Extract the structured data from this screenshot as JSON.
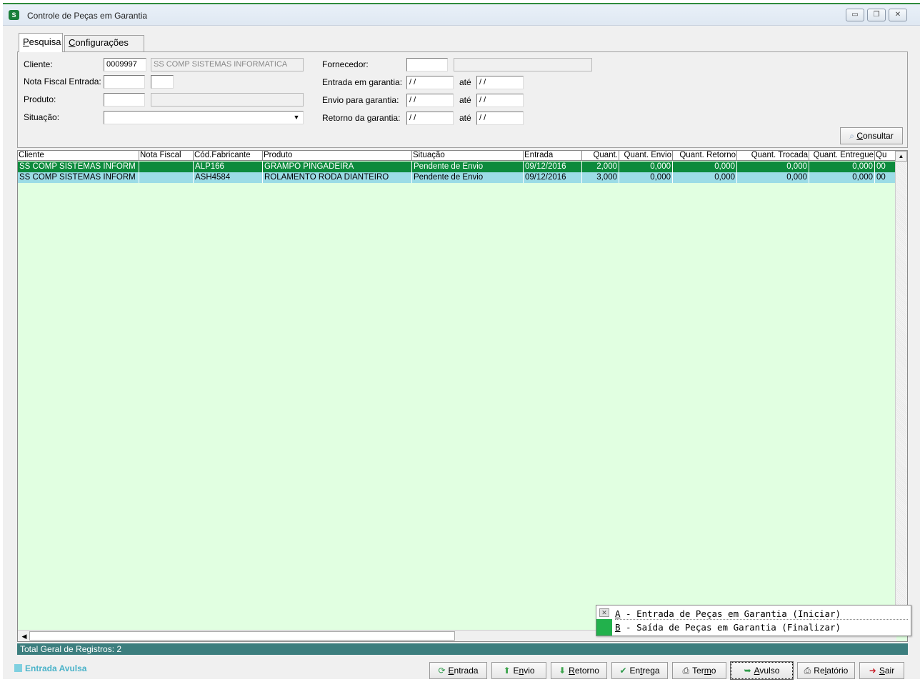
{
  "window": {
    "title": "Controle de Peças em Garantia",
    "controls": [
      "minimize",
      "restore",
      "close"
    ]
  },
  "tabs": [
    {
      "label": "Pesquisa",
      "underline": "P",
      "rest": "esquisa",
      "active": true
    },
    {
      "label": "Configurações",
      "underline": "C",
      "rest": "onfigurações",
      "active": false
    }
  ],
  "search": {
    "cliente_label": "Cliente:",
    "cliente_code": "0009997",
    "cliente_name": "SS COMP SISTEMAS INFORMATICA",
    "nota_label": "Nota Fiscal Entrada:",
    "nota_value": "",
    "nota_serie": "",
    "produto_label": "Produto:",
    "produto_code": "",
    "produto_name": "",
    "situacao_label": "Situação:",
    "situacao_value": "",
    "fornecedor_label": "Fornecedor:",
    "fornecedor_code": "",
    "fornecedor_name": "",
    "entrada_label": "Entrada em garantia:",
    "envio_label": "Envio para garantia:",
    "retorno_label": "Retorno da garantia:",
    "ate_label": "até",
    "date_empty": " / /",
    "consultar_label": "Consultar",
    "consultar_u": "C",
    "consultar_rest": "onsultar"
  },
  "grid": {
    "columns": [
      "Cliente",
      "Nota Fiscal",
      "Cód.Fabricante",
      "Produto",
      "Situação",
      "Entrada",
      "Quant.",
      "Quant. Envio",
      "Quant. Retorno",
      "Quant. Trocada",
      "Quant. Entregue",
      "Qu"
    ],
    "rows": [
      {
        "cliente": "SS COMP SISTEMAS INFORM",
        "nota": "",
        "cod": "ALP166",
        "produto": "GRAMPO PINGADEIRA",
        "situacao": "Pendente de Envio",
        "entrada": "09/12/2016",
        "quant": "2,000",
        "envio": "0,000",
        "retorno": "0,000",
        "trocada": "0,000",
        "entregue": "0,000",
        "extra": "00"
      },
      {
        "cliente": "SS COMP SISTEMAS INFORM",
        "nota": "",
        "cod": "ASH4584",
        "produto": "ROLAMENTO RODA DIANTEIRO",
        "situacao": "Pendente de Envio",
        "entrada": "09/12/2016",
        "quant": "3,000",
        "envio": "0,000",
        "retorno": "0,000",
        "trocada": "0,000",
        "entregue": "0,000",
        "extra": "00"
      }
    ]
  },
  "status": {
    "total": "Total Geral de Registros: 2",
    "legend": "Entrada Avulsa"
  },
  "popup": {
    "item_a_key": "A",
    "item_a_text": " - Entrada de Peças em Garantia (Iniciar)",
    "item_b_key": "B",
    "item_b_text": " - Saída de Peças em Garantia (Finalizar)"
  },
  "buttons": {
    "entrada": {
      "u": "E",
      "rest": "ntrada"
    },
    "envio": {
      "pre": "E",
      "u": "n",
      "rest": "vio"
    },
    "retorno": {
      "u": "R",
      "rest": "etorno"
    },
    "entrega": {
      "pre": "En",
      "u": "t",
      "rest": "rega"
    },
    "termo": {
      "pre": "Ter",
      "u": "m",
      "rest": "o"
    },
    "avulso": {
      "u": "A",
      "rest": "vulso"
    },
    "relatorio": {
      "pre": "Re",
      "u": "l",
      "rest": "atório"
    },
    "sair": {
      "u": "S",
      "rest": "air"
    }
  },
  "colors": {
    "selected_row": "#0c8a3c",
    "alt_row": "#9cdce6",
    "grid_bg": "#e1ffe1",
    "status_bar": "#3c7e7e"
  }
}
